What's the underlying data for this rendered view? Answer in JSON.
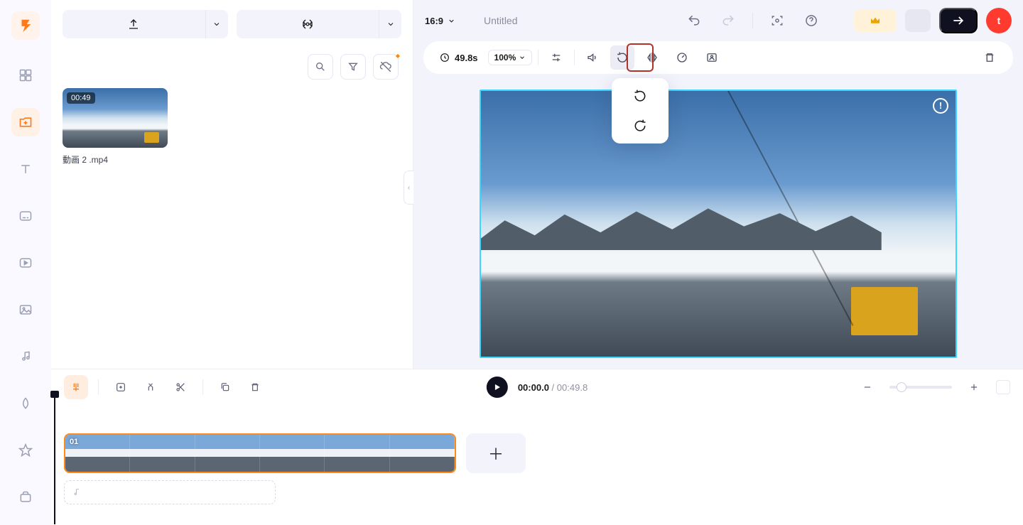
{
  "sidebar": {
    "logo_letter": "F",
    "items": [
      {
        "name": "templates-icon"
      },
      {
        "name": "media-icon",
        "active": true
      },
      {
        "name": "text-icon"
      },
      {
        "name": "subtitles-icon"
      },
      {
        "name": "videos-icon"
      },
      {
        "name": "images-icon"
      },
      {
        "name": "audio-icon"
      },
      {
        "name": "effects-icon"
      },
      {
        "name": "stickers-icon"
      },
      {
        "name": "branding-icon"
      }
    ]
  },
  "media_panel": {
    "upload_label": "",
    "record_label": "",
    "tools": [
      "search",
      "filter",
      "visibility"
    ],
    "clip": {
      "duration_badge": "00:49",
      "filename": "動画 2 .mp4"
    }
  },
  "topbar": {
    "aspect_ratio": "16:9",
    "project_title": "Untitled",
    "avatar_letter": "t"
  },
  "editbar": {
    "duration": "49.8s",
    "zoom": "100%",
    "rotate_popover": {
      "options": [
        "rotate-ccw",
        "rotate-cw"
      ]
    }
  },
  "preview": {
    "warn": "!"
  },
  "timeline": {
    "playback": {
      "current": "00:00.0",
      "separator": "/",
      "total": "00:49.8"
    },
    "clip_index": "01"
  }
}
